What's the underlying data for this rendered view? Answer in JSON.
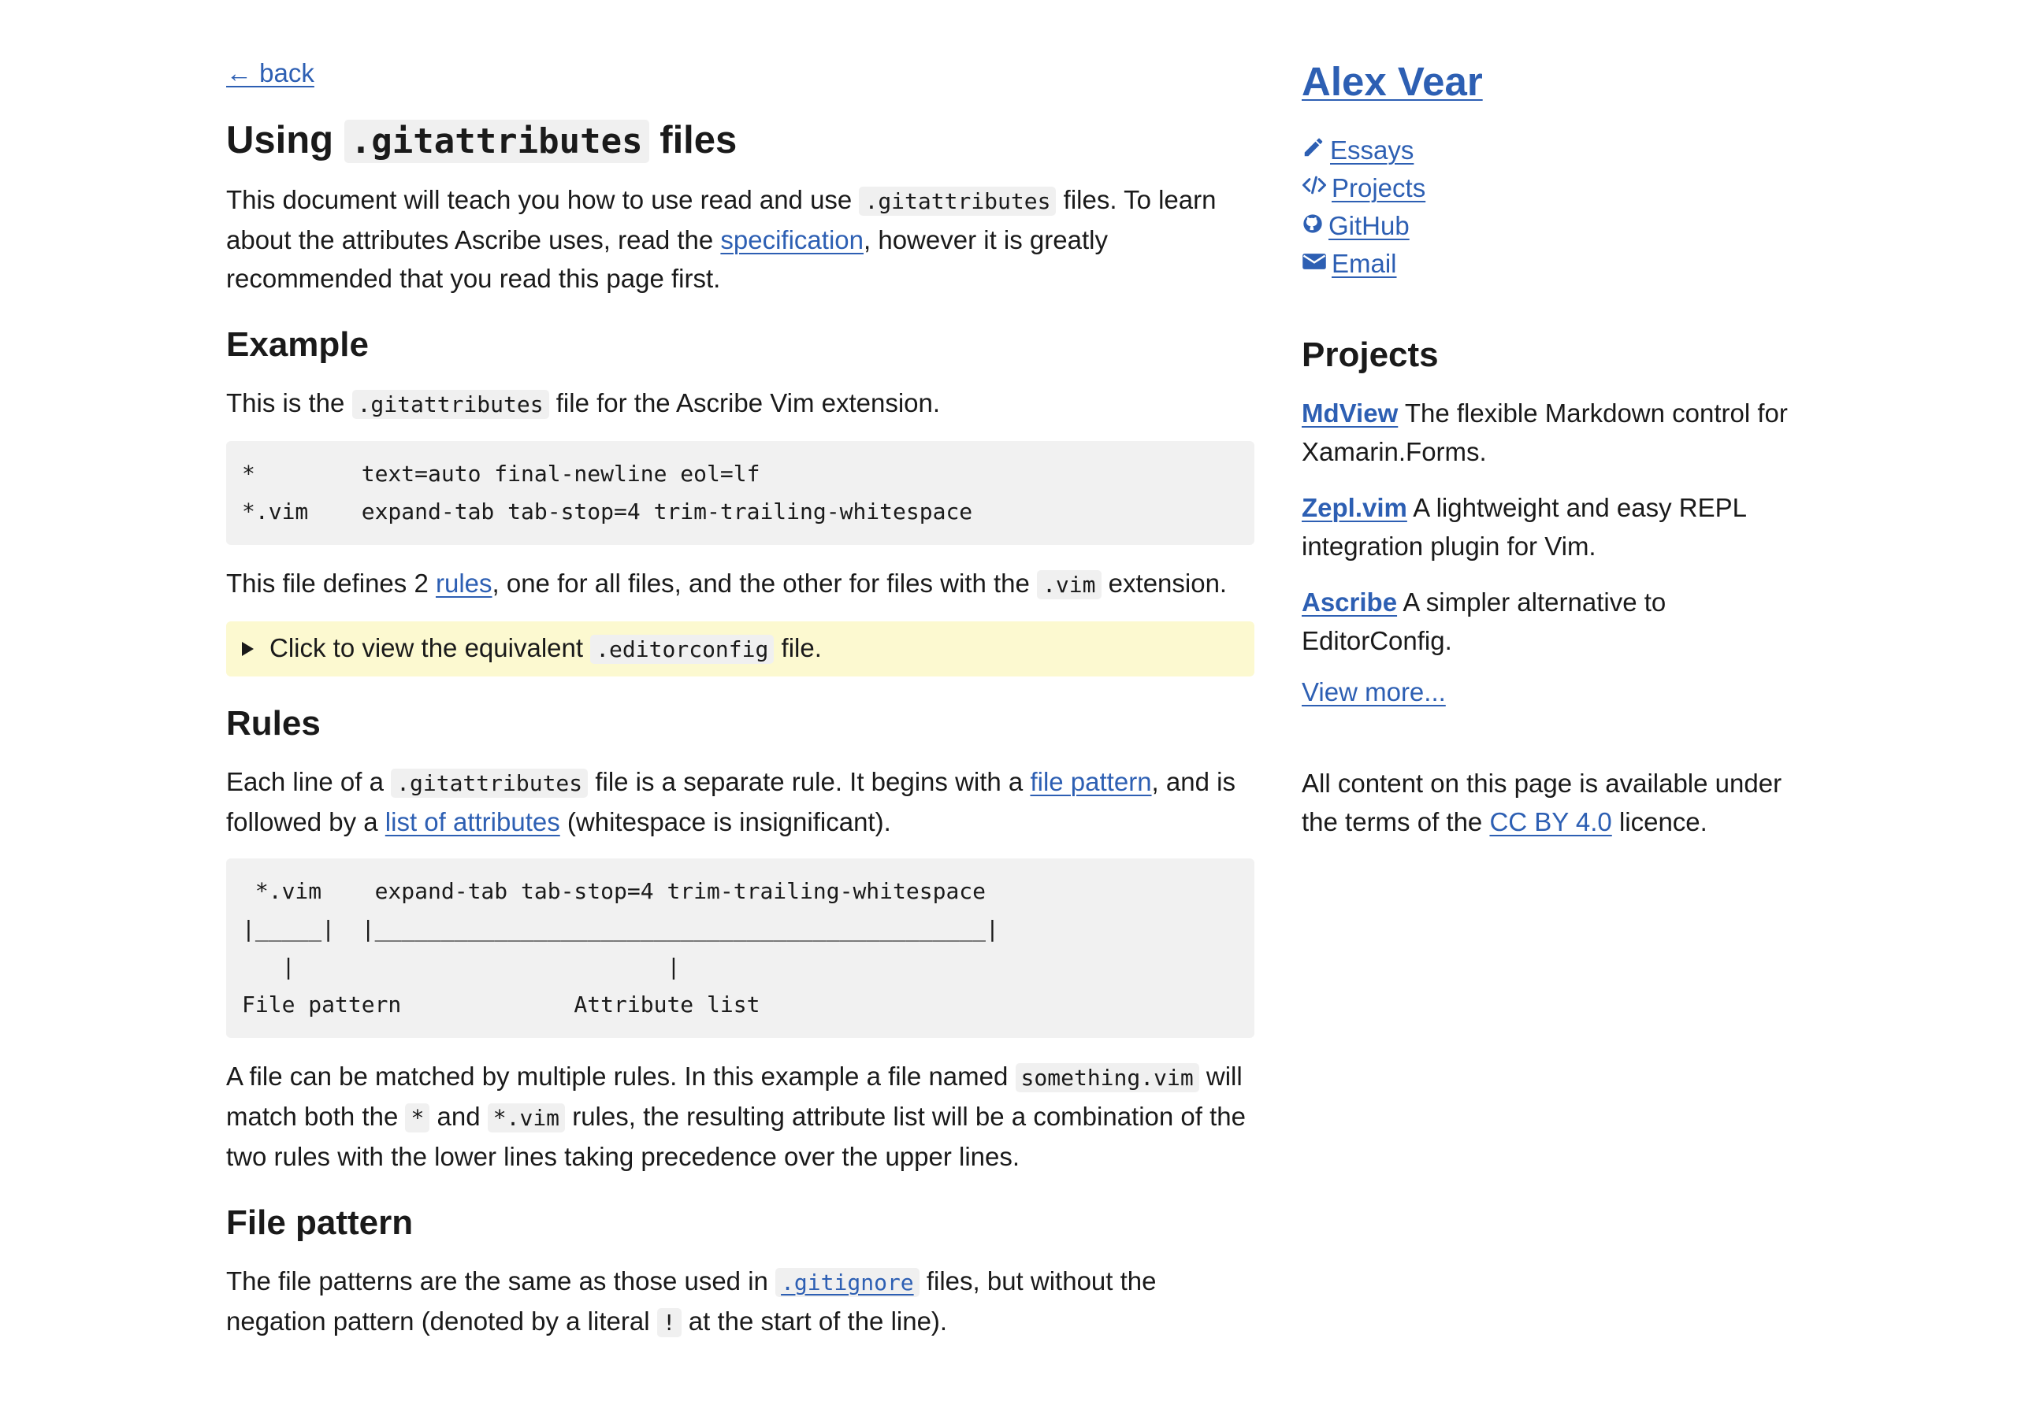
{
  "article": {
    "back_link": "← back",
    "title_pre": "Using",
    "title_code": ".gitattributes",
    "title_post": "files",
    "intro": {
      "t1": "This document will teach you how to use read and use",
      "c1": ".gitattributes",
      "t2": "files.  To learn about the attributes Ascribe uses, read the",
      "link": "specification",
      "t3": ", however it is greatly recommended that you read this page first."
    },
    "example": {
      "heading": "Example",
      "p1_t1": "This is the",
      "p1_c1": ".gitattributes",
      "p1_t2": "file for the Ascribe Vim extension.",
      "code": "*        text=auto final-newline eol=lf\n*.vim    expand-tab tab-stop=4 trim-trailing-whitespace",
      "p2_t1": "This file defines 2",
      "p2_link": "rules",
      "p2_t2": ", one for all files, and the other for files with the",
      "p2_c1": ".vim",
      "p2_t3": "extension.",
      "details_t1": "Click to view the equivalent",
      "details_c1": ".editorconfig",
      "details_t2": "file."
    },
    "rules": {
      "heading": "Rules",
      "p1_t1": "Each line of a",
      "p1_c1": ".gitattributes",
      "p1_t2": "file is a separate rule.  It begins with a",
      "p1_link1": "file pattern",
      "p1_t3": ", and is followed by a",
      "p1_link2": "list of attributes",
      "p1_t4": "(whitespace is insignificant).",
      "code": " *.vim    expand-tab tab-stop=4 trim-trailing-whitespace\n|_____|  |______________________________________________|\n   |                            |\nFile pattern             Attribute list",
      "p2_t1": "A file can be matched by multiple rules.  In this example a file named",
      "p2_c1": "something.vim",
      "p2_t2": "will match both the",
      "p2_c2": "*",
      "p2_t3": "and",
      "p2_c3": "*.vim",
      "p2_t4": "rules, the resulting attribute list will be a combination of the two rules with the lower lines taking precedence over the upper lines."
    },
    "file_pattern": {
      "heading": "File pattern",
      "t1": "The file patterns are the same as those used in",
      "link_code": ".gitignore",
      "t2": "files, but without the negation pattern (denoted by a literal",
      "c1": "!",
      "t3": "at the start of the line)."
    }
  },
  "sidebar": {
    "site_title": "Alex Vear",
    "nav": [
      {
        "label": "Essays",
        "icon": "pencil-icon"
      },
      {
        "label": "Projects",
        "icon": "code-icon"
      },
      {
        "label": "GitHub",
        "icon": "github-icon"
      },
      {
        "label": "Email",
        "icon": "envelope-icon"
      }
    ],
    "projects_heading": "Projects",
    "projects": [
      {
        "name": "MdView",
        "desc": "The flexible Markdown control for Xamarin.Forms."
      },
      {
        "name": "Zepl.vim",
        "desc": "A lightweight and easy REPL integration plugin for Vim."
      },
      {
        "name": "Ascribe",
        "desc": "A simpler alternative to EditorConfig."
      }
    ],
    "view_more": "View more...",
    "license_t1": "All content on this page is available under the terms of the",
    "license_link": "CC BY 4.0",
    "license_t2": "licence."
  },
  "colors": {
    "link": "#2d5fb3",
    "details_bg": "#fcf9d0",
    "code_bg": "#f1f1f1"
  }
}
